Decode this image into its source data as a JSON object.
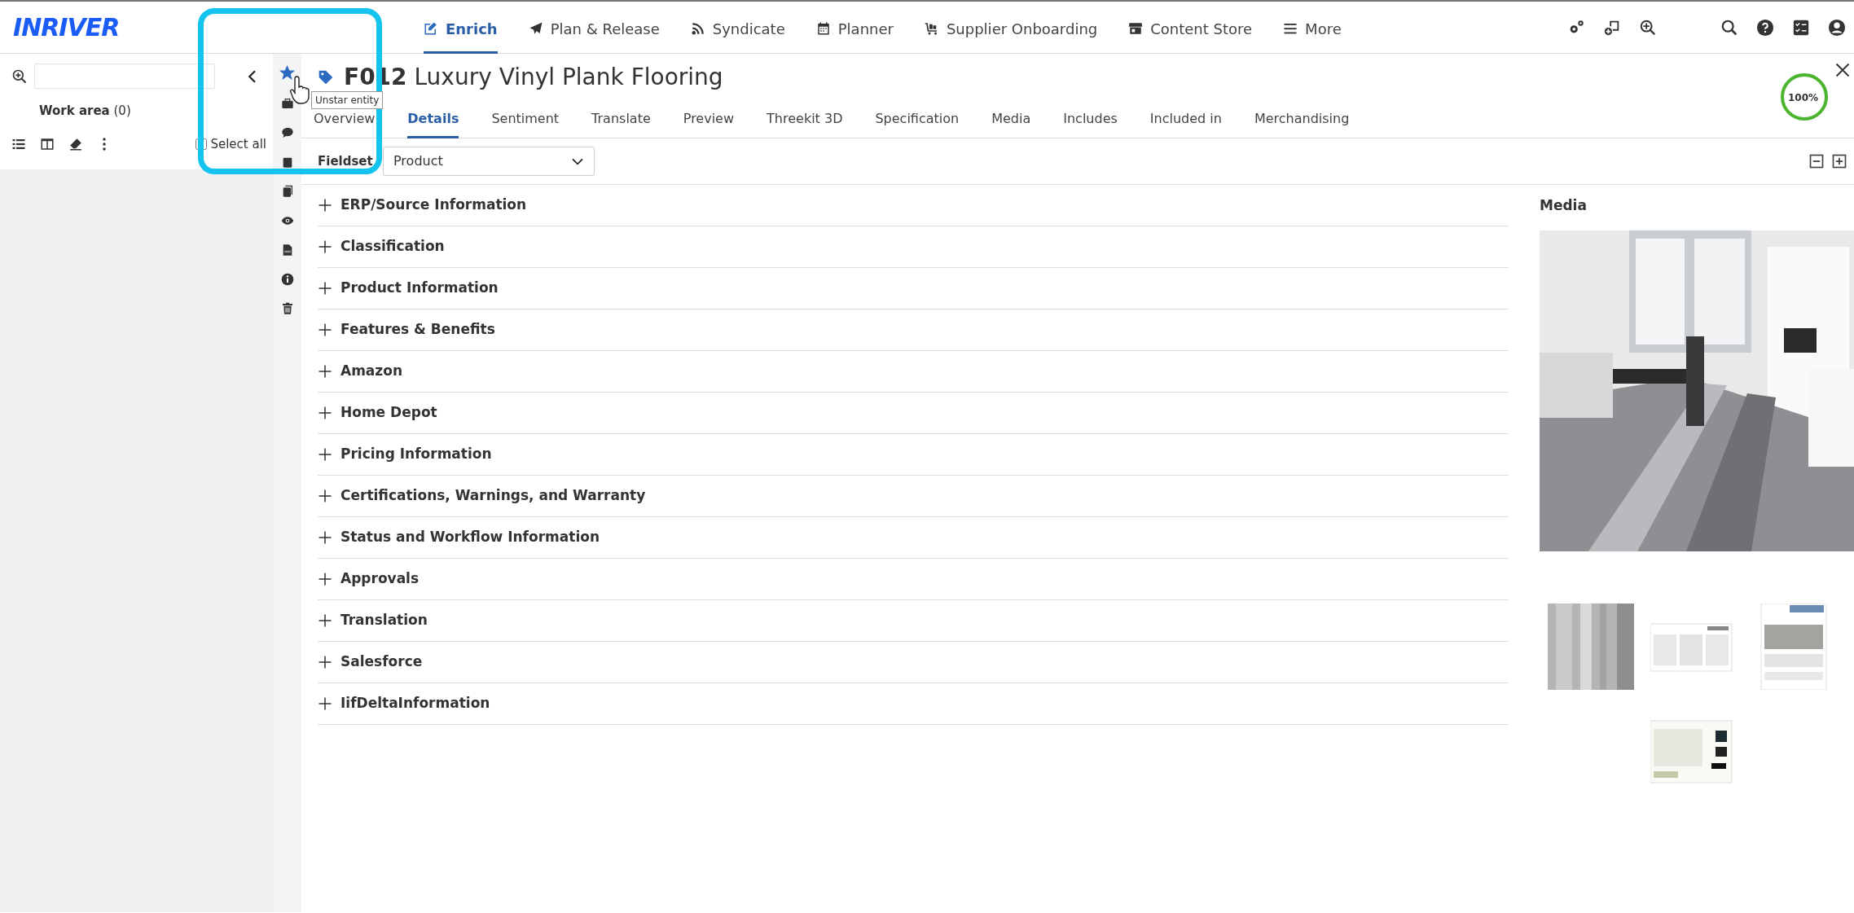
{
  "logo": "INRIVER",
  "nav": [
    {
      "label": "Enrich",
      "kind": "edit",
      "selected": true
    },
    {
      "label": "Plan & Release",
      "kind": "plane",
      "selected": false
    },
    {
      "label": "Syndicate",
      "kind": "rss",
      "selected": false
    },
    {
      "label": "Planner",
      "kind": "calendar",
      "selected": false
    },
    {
      "label": "Supplier Onboarding",
      "kind": "cart",
      "selected": false
    },
    {
      "label": "Content Store",
      "kind": "store",
      "selected": false
    },
    {
      "label": "More",
      "kind": "menu",
      "selected": false
    }
  ],
  "left_panel": {
    "work_area": {
      "label": "Work area",
      "count": "(0)"
    },
    "select_all": {
      "label": "Select all",
      "checked": false
    }
  },
  "entity": {
    "starred": true,
    "code": "F012",
    "name": "Luxury Vinyl Plank Flooring",
    "completeness": "100%",
    "level": 1
  },
  "tooltip": "Unstar entity",
  "tabs": [
    {
      "label": "Overview",
      "selected": false
    },
    {
      "label": "Details",
      "selected": true
    },
    {
      "label": "Sentiment",
      "selected": false
    },
    {
      "label": "Translate",
      "selected": false
    },
    {
      "label": "Preview",
      "selected": false
    },
    {
      "label": "Threekit 3D",
      "selected": false
    },
    {
      "label": "Specification",
      "selected": false
    },
    {
      "label": "Media",
      "selected": false
    },
    {
      "label": "Includes",
      "selected": false
    },
    {
      "label": "Included in",
      "selected": false
    },
    {
      "label": "Merchandising",
      "selected": false
    }
  ],
  "fieldset": {
    "label": "Fieldset",
    "value": "Product"
  },
  "sections": [
    {
      "title": "ERP/Source Information",
      "expanded": false
    },
    {
      "title": "Classification",
      "expanded": false
    },
    {
      "title": "Product Information",
      "expanded": false
    },
    {
      "title": "Features & Benefits",
      "expanded": false
    },
    {
      "title": "Amazon",
      "expanded": false
    },
    {
      "title": "Home Depot",
      "expanded": false
    },
    {
      "title": "Pricing Information",
      "expanded": false
    },
    {
      "title": "Certifications, Warnings, and Warranty",
      "expanded": false
    },
    {
      "title": "Status and Workflow Information",
      "expanded": false
    },
    {
      "title": "Approvals",
      "expanded": false
    },
    {
      "title": "Translation",
      "expanded": false
    },
    {
      "title": "Salesforce",
      "expanded": false
    },
    {
      "title": "IifDeltaInformation",
      "expanded": false
    }
  ],
  "media": {
    "title": "Media",
    "thumbnails": [
      {
        "kind": "wood"
      },
      {
        "kind": "sheet"
      },
      {
        "kind": "flyer"
      },
      {
        "kind": "card"
      }
    ]
  }
}
